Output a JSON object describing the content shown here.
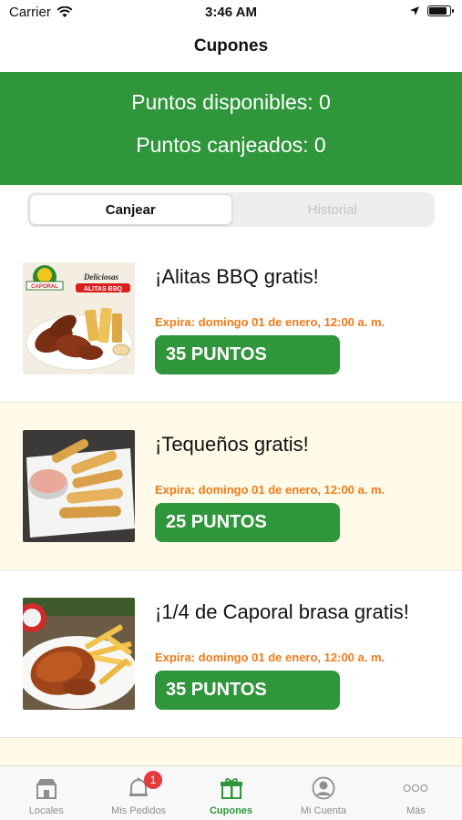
{
  "status_bar": {
    "carrier": "Carrier",
    "time": "3:46 AM",
    "battery_level": 0.85
  },
  "nav": {
    "title": "Cupones"
  },
  "points": {
    "available_label": "Puntos disponibles: 0",
    "redeemed_label": "Puntos canjeados: 0"
  },
  "segments": [
    {
      "label": "Canjear",
      "active": true
    },
    {
      "label": "Historial",
      "active": false
    }
  ],
  "coupons": [
    {
      "title": "¡Alitas BBQ gratis!",
      "expiry": "Expira: domingo 01 de enero, 12:00 a. m.",
      "points": "35 PUNTOS",
      "image": "bbq-wings-photo",
      "promo_brand": "CAPORAL",
      "promo_text": "Deliciosas",
      "promo_banner": "ALITAS BBQ"
    },
    {
      "title": "¡Tequeños gratis!",
      "expiry": "Expira: domingo 01 de enero, 12:00 a. m.",
      "points": "25 PUNTOS",
      "image": "tequenos-photo"
    },
    {
      "title": "¡1/4 de Caporal brasa gratis!",
      "expiry": "Expira: domingo 01 de enero, 12:00 a. m.",
      "points": "35 PUNTOS",
      "image": "roast-chicken-photo"
    }
  ],
  "tabs": [
    {
      "label": "Locales",
      "icon": "store-icon",
      "active": false
    },
    {
      "label": "Mis Pedidos",
      "icon": "bell-icon",
      "active": false,
      "badge": "1"
    },
    {
      "label": "Cupones",
      "icon": "gift-icon",
      "active": true
    },
    {
      "label": "Mi Cuenta",
      "icon": "user-icon",
      "active": false
    },
    {
      "label": "Más",
      "icon": "more-icon",
      "active": false
    }
  ],
  "colors": {
    "brand_green": "#2f963b",
    "expiry_orange": "#ee7b1b",
    "badge_red": "#e23b3b",
    "alt_row": "#fffbe8"
  }
}
